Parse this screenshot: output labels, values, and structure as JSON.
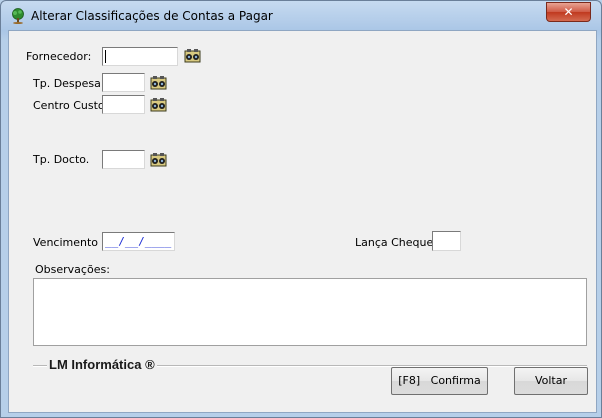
{
  "window": {
    "title": "Alterar Classificações de Contas a Pagar",
    "close_label": "✕"
  },
  "form": {
    "fornecedor_label": "Fornecedor:",
    "tp_despesa_label": "Tp. Despesa:",
    "centro_custo_label": "Centro Custo:",
    "tp_docto_label": "Tp. Docto.",
    "vencimento_label": "Vencimento",
    "vencimento_value": "__/__/____",
    "lanca_cheque_label": "Lança Cheque:",
    "observacoes_label": "Observações:"
  },
  "footer": {
    "brand": "LM Informática ®",
    "confirm_label": "[F8]   Confirma",
    "back_label": "Voltar"
  },
  "icons": {
    "window_icon": "app-tree-icon",
    "lookup_icon": "binoculars-icon"
  },
  "colors": {
    "title_bar": "#b9d1ea",
    "close_button": "#c9462c",
    "date_mask": "#1b2bd4"
  }
}
